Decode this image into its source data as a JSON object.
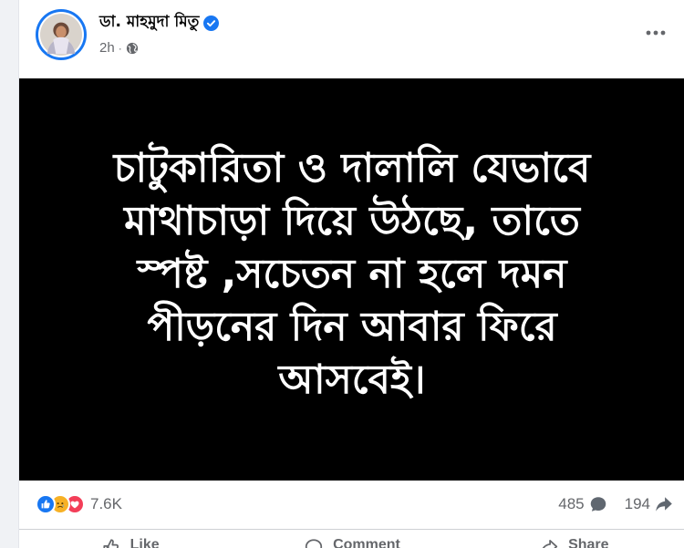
{
  "post": {
    "author": "ডা. মাহমুদা মিতু",
    "time": "2h",
    "meta_separator": "·",
    "image_text_lines": [
      "চাটুকারিতা ও দালালি যেভাবে",
      "মাথাচাড়া দিয়ে উঠছে, তাতে",
      "স্পষ্ট ,সচেতন না হলে দমন",
      "পীড়নের দিন আবার ফিরে",
      "আসবেই।"
    ]
  },
  "stats": {
    "reaction_count": "7.6K",
    "comment_count": "485",
    "share_count": "194"
  },
  "actions": {
    "like_label": "Like",
    "comment_label": "Comment",
    "share_label": "Share"
  },
  "colors": {
    "accent": "#1877f2",
    "image_background": "#000000",
    "image_text": "#ffffff",
    "secondary_text": "#65676b"
  },
  "icons": {
    "verified": "verified-badge-icon",
    "privacy": "globe-icon",
    "more": "more-horizontal-icon",
    "reactions": [
      "like-reaction-icon",
      "sad-reaction-icon",
      "love-reaction-icon"
    ],
    "comment": "comment-bubble-icon",
    "share": "share-arrow-icon"
  }
}
